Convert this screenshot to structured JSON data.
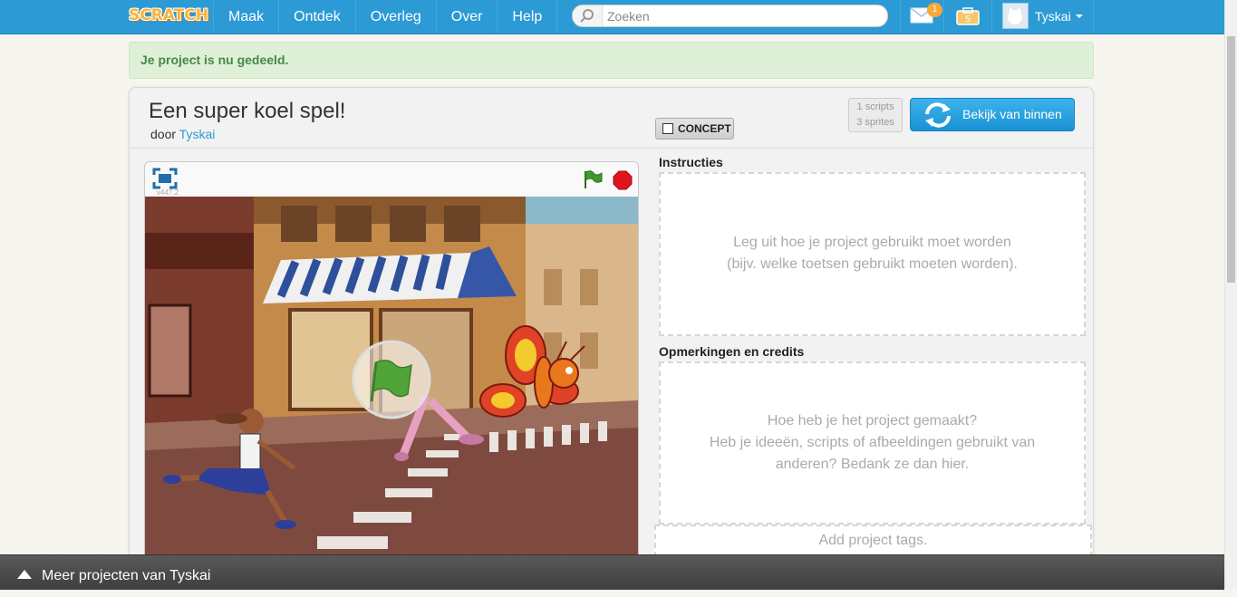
{
  "nav": {
    "logo": "SCRATCH",
    "items": [
      {
        "label": "Maak"
      },
      {
        "label": "Ontdek"
      },
      {
        "label": "Overleg"
      },
      {
        "label": "Over"
      },
      {
        "label": "Help"
      }
    ],
    "search_placeholder": "Zoeken",
    "messages_count": "1",
    "username": "Tyskai",
    "icons": [
      "search-icon",
      "messages-icon",
      "my-stuff-icon",
      "chevron-down-icon"
    ]
  },
  "banner": {
    "text": "Je project is nu gedeeld."
  },
  "project": {
    "title": "Een super koel spel!",
    "by_prefix": "door",
    "author": "Tyskai",
    "concept_label": "CONCEPT",
    "stats": {
      "scripts": "1 scripts",
      "sprites": "3 sprites"
    },
    "see_inside_label": "Bekijk van binnen",
    "player": {
      "version": "v447.2"
    },
    "instructions": {
      "label": "Instructies",
      "placeholder_lines": [
        "Leg uit hoe je project gebruikt moet worden",
        "(bijv. welke toetsen gebruikt moeten worden)."
      ]
    },
    "notes": {
      "label": "Opmerkingen en credits",
      "placeholder_lines": [
        "Hoe heb je het project gemaakt?",
        "Heb je ideeën, scripts of afbeeldingen gebruikt van",
        "anderen? Bedank ze dan hier."
      ]
    },
    "tags_placeholder": "Add project tags."
  },
  "bottom_bar": {
    "label": "Meer projecten van Tyskai"
  },
  "colors": {
    "brand": "#2b9ad5",
    "success_bg": "#dff0d8",
    "success_text": "#468847",
    "badge": "#f9a739"
  }
}
